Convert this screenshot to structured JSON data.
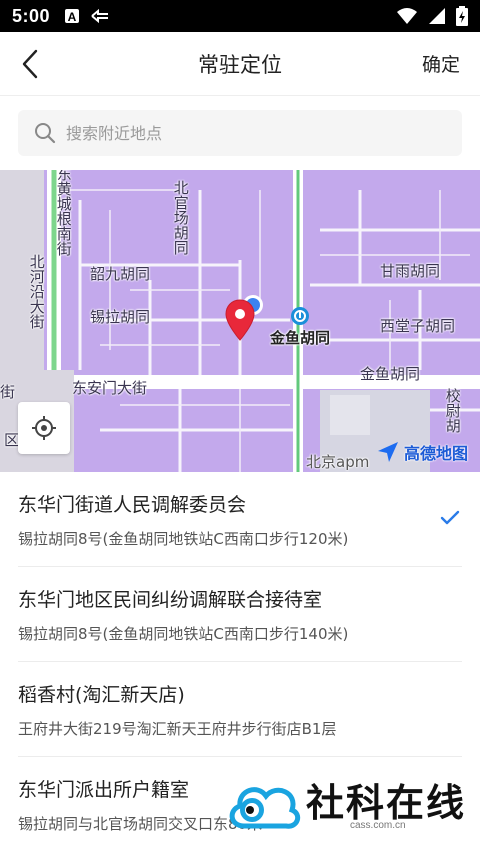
{
  "status_bar": {
    "time": "5:00"
  },
  "nav": {
    "title": "常驻定位",
    "confirm_label": "确定"
  },
  "search": {
    "placeholder": "搜索附近地点"
  },
  "map": {
    "labels": {
      "dong_huang_cheng_gen_nan_jie": "东黄城根南街",
      "bei_guan_chang_hutong": "北官场胡同",
      "shao_jiu_hutong": "韶九胡同",
      "xi_la_hutong": "锡拉胡同",
      "bei_he_yan_da_jie": "北河沿大街",
      "jinyu_hutong_station": "金鱼胡同",
      "gan_yu_hutong": "甘雨胡同",
      "xi_tang_zi_hutong": "西堂子胡同",
      "jin_yu_hutong_east": "金鱼胡同",
      "dong_an_men_da_jie": "东安门大街",
      "xiao_wei_hutong": "校尉胡",
      "jie": "街",
      "qu": "区",
      "beijing_apm": "北京apm"
    },
    "logo_text": "高德地图",
    "colors": {
      "block": "#c3a9ec",
      "road": "#f4f1f8",
      "main_road": "#ffffff",
      "green_line": "#62c97c",
      "pin": "#e8283a",
      "user_dot": "#3b82f0"
    }
  },
  "results": [
    {
      "name": "东华门街道人民调解委员会",
      "address": "锡拉胡同8号(金鱼胡同地铁站C西南口步行120米)",
      "selected": true
    },
    {
      "name": "东华门地区民间纠纷调解联合接待室",
      "address": "锡拉胡同8号(金鱼胡同地铁站C西南口步行140米)",
      "selected": false
    },
    {
      "name": "稻香村(淘汇新天店)",
      "address": "王府井大街219号淘汇新天王府井步行街店B1层",
      "selected": false
    },
    {
      "name": "东华门派出所户籍室",
      "address": "锡拉胡同与北官场胡同交叉口东80米",
      "selected": false
    }
  ],
  "watermark": {
    "text": "社科在线",
    "url": "cass.com.cn"
  },
  "icons": [
    "back-arrow-icon",
    "search-icon",
    "locate-icon",
    "check-icon",
    "map-pin-icon",
    "amap-logo-icon"
  ]
}
